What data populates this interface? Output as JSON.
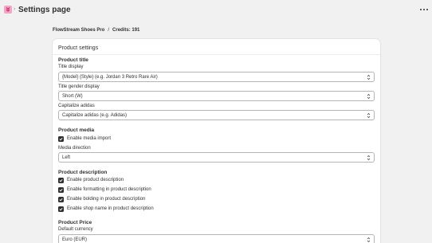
{
  "topbar": {
    "app_icon": "app-logo-icon",
    "title": "Settings page",
    "menu_icon": "more-horizontal-icon"
  },
  "breadcrumb": {
    "shop": "FlowStream Shoes Pro",
    "separator": "/",
    "credits": "Credits: 191"
  },
  "card": {
    "header": "Product settings",
    "product_title": {
      "heading": "Product title",
      "title_display_label": "Title display",
      "title_display_value": "{Model} {Style} (e.g. Jordan 3 Retro Rare Air)",
      "gender_label": "Title gender display",
      "gender_value": "Short (W)",
      "capitalize_label": "Capitalize adidas",
      "capitalize_value": "Capitalize adidas (e.g. Adidas)"
    },
    "product_media": {
      "heading": "Product media",
      "enable_import": "Enable media import",
      "enable_import_checked": true,
      "direction_label": "Media direction",
      "direction_value": "Left"
    },
    "product_description": {
      "heading": "Product description",
      "options": [
        {
          "label": "Enable product description",
          "checked": true
        },
        {
          "label": "Enable formatting in product description",
          "checked": true
        },
        {
          "label": "Enable bolding in product description",
          "checked": true
        },
        {
          "label": "Enable shop name in product description",
          "checked": true
        }
      ]
    },
    "product_price": {
      "heading": "Product Price",
      "currency_label": "Default currency",
      "currency_value": "Euro (EUR)"
    }
  },
  "colors": {
    "background": "#f1f1f1",
    "card": "#ffffff",
    "checkbox": "#303030",
    "app_icon": "#f3a6c4"
  }
}
